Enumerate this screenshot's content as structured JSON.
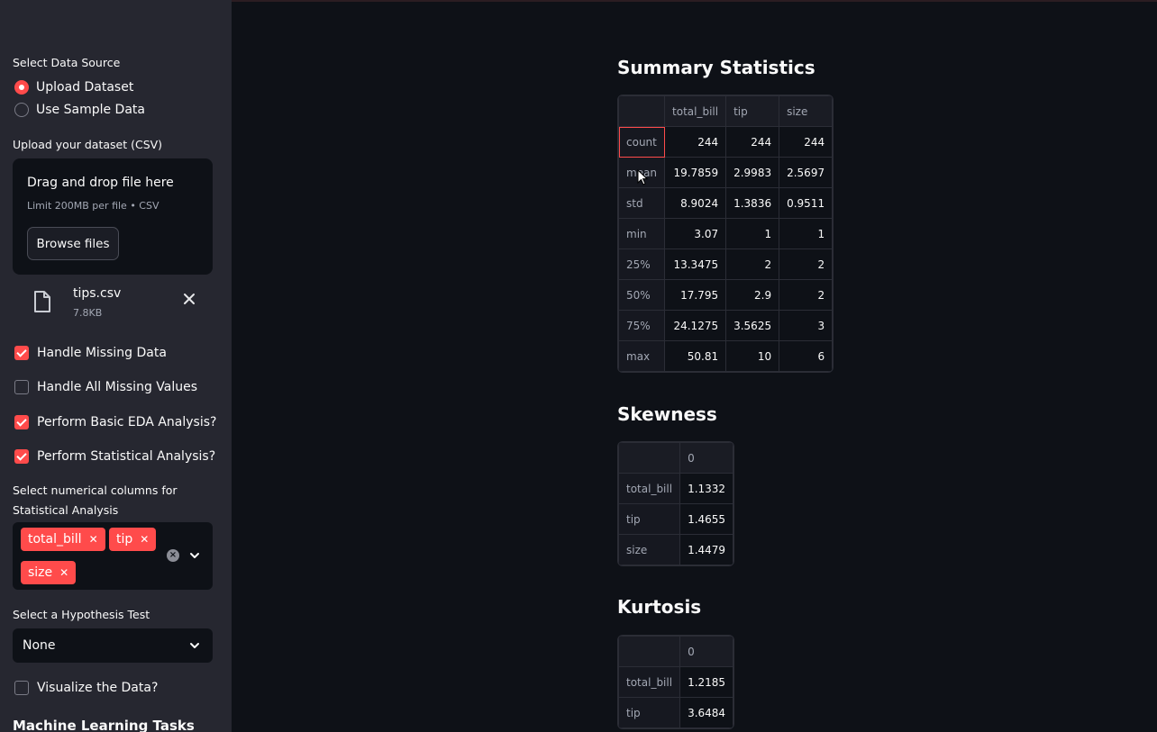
{
  "sidebar": {
    "data_source_label": "Select Data Source",
    "data_source_options": [
      {
        "label": "Upload Dataset",
        "selected": true
      },
      {
        "label": "Use Sample Data",
        "selected": false
      }
    ],
    "upload_label": "Upload your dataset (CSV)",
    "uploader": {
      "title": "Drag and drop file here",
      "limit": "Limit 200MB per file • CSV",
      "browse_label": "Browse files"
    },
    "file": {
      "name": "tips.csv",
      "size": "7.8KB"
    },
    "checkboxes": [
      {
        "label": "Handle Missing Data",
        "checked": true
      },
      {
        "label": "Handle All Missing Values",
        "checked": false
      },
      {
        "label": "Perform Basic EDA Analysis?",
        "checked": true
      },
      {
        "label": "Perform Statistical Analysis?",
        "checked": true
      }
    ],
    "columns_label": "Select numerical columns for Statistical Analysis",
    "selected_columns": [
      "total_bill",
      "tip",
      "size"
    ],
    "hypothesis_label": "Select a Hypothesis Test",
    "hypothesis_value": "None",
    "visualize_label": "Visualize the Data?",
    "visualize_checked": false,
    "ml_heading": "Machine Learning Tasks"
  },
  "main": {
    "summary_title": "Summary Statistics",
    "summary_table": {
      "columns": [
        "",
        "total_bill",
        "tip",
        "size"
      ],
      "rows": [
        [
          "count",
          "244",
          "244",
          "244"
        ],
        [
          "mean",
          "19.7859",
          "2.9983",
          "2.5697"
        ],
        [
          "std",
          "8.9024",
          "1.3836",
          "0.9511"
        ],
        [
          "min",
          "3.07",
          "1",
          "1"
        ],
        [
          "25%",
          "13.3475",
          "2",
          "2"
        ],
        [
          "50%",
          "17.795",
          "2.9",
          "2"
        ],
        [
          "75%",
          "24.1275",
          "3.5625",
          "3"
        ],
        [
          "max",
          "50.81",
          "10",
          "6"
        ]
      ]
    },
    "skewness_title": "Skewness",
    "skewness_table": {
      "columns": [
        "",
        "0"
      ],
      "rows": [
        [
          "total_bill",
          "1.1332"
        ],
        [
          "tip",
          "1.4655"
        ],
        [
          "size",
          "1.4479"
        ]
      ]
    },
    "kurtosis_title": "Kurtosis",
    "kurtosis_table": {
      "columns": [
        "",
        "0"
      ],
      "rows": [
        [
          "total_bill",
          "1.2185"
        ],
        [
          "tip",
          "3.6484"
        ]
      ]
    }
  },
  "colors": {
    "accent": "#ff4b4b",
    "sidebar_bg": "#262730",
    "main_bg": "#0e1117"
  }
}
